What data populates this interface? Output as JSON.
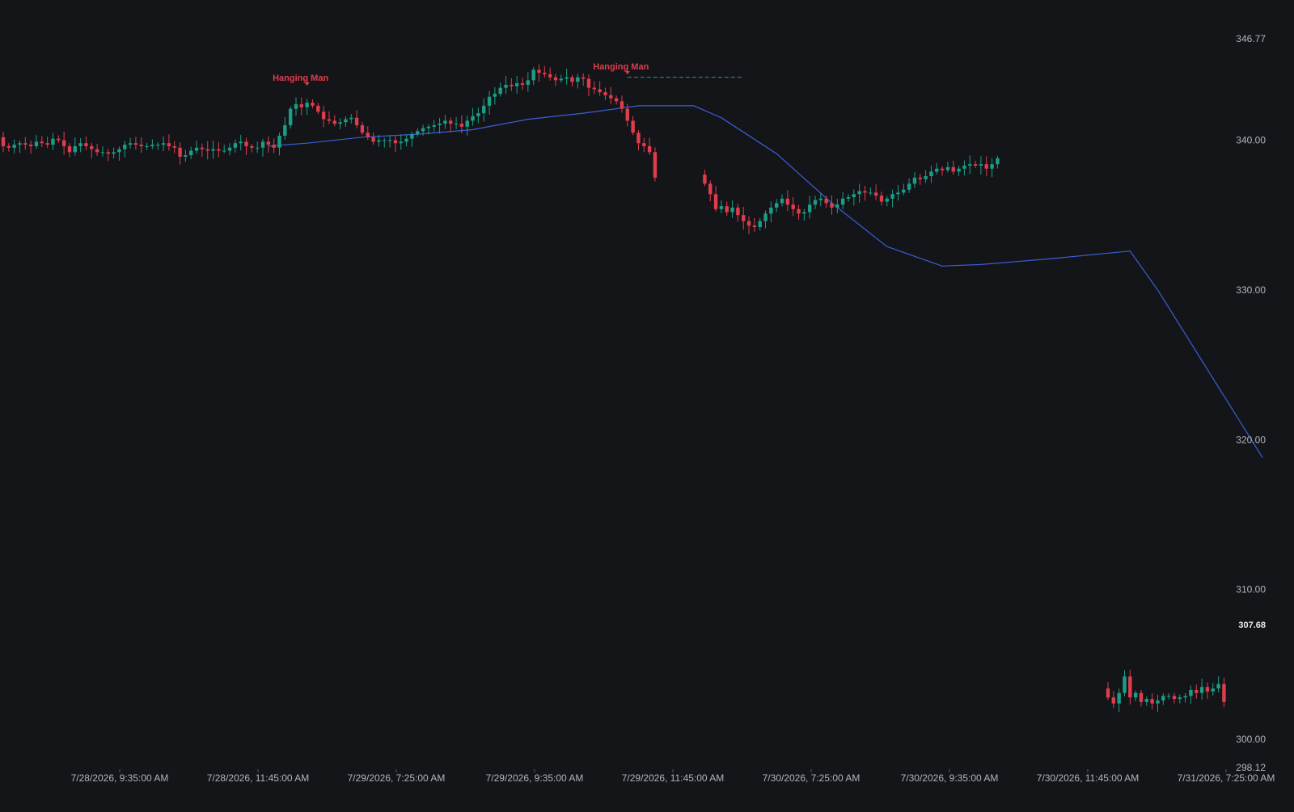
{
  "chart_data": {
    "type": "candlestick",
    "y_ticks": [
      346.77,
      340.0,
      330.0,
      320.0,
      310.0,
      300.0,
      298.12
    ],
    "ylim": [
      298.12,
      346.77
    ],
    "last_price_label": "307.68",
    "x_tick_labels": [
      "7/28/2026, 9:35:00 AM",
      "7/28/2026, 11:45:00 AM",
      "7/29/2026, 7:25:00 AM",
      "7/29/2026, 9:35:00 AM",
      "7/29/2026, 11:45:00 AM",
      "7/30/2026, 7:25:00 AM",
      "7/30/2026, 9:35:00 AM",
      "7/30/2026, 11:45:00 AM",
      "7/31/2026, 7:25:00 AM"
    ],
    "annotations": [
      {
        "text": "Hanging Man",
        "bar_index": 55
      },
      {
        "text": "Hanging Man",
        "bar_index": 113
      }
    ],
    "reference_line": {
      "price": 344.2,
      "from_bar": 113,
      "to_bar": 134
    },
    "moving_average": [
      {
        "bar": 48,
        "price": 339.6
      },
      {
        "bar": 55,
        "price": 339.8
      },
      {
        "bar": 65,
        "price": 340.2
      },
      {
        "bar": 75,
        "price": 340.4
      },
      {
        "bar": 85,
        "price": 340.7
      },
      {
        "bar": 95,
        "price": 341.4
      },
      {
        "bar": 105,
        "price": 341.8
      },
      {
        "bar": 115,
        "price": 342.3
      },
      {
        "bar": 125,
        "price": 342.3
      },
      {
        "bar": 130,
        "price": 341.5
      },
      {
        "bar": 140,
        "price": 339.1
      },
      {
        "bar": 150,
        "price": 335.8
      },
      {
        "bar": 160,
        "price": 332.9
      },
      {
        "bar": 170,
        "price": 331.6
      },
      {
        "bar": 177,
        "price": 331.7
      },
      {
        "bar": 190,
        "price": 332.1
      },
      {
        "bar": 204,
        "price": 332.6
      },
      {
        "bar": 209,
        "price": 330.0
      },
      {
        "bar": 228,
        "price": 318.8
      }
    ],
    "candle_segments": [
      {
        "start_bar": 0,
        "prices": [
          339.6,
          339.5,
          339.7,
          339.8,
          339.7,
          339.6,
          339.9,
          339.8,
          339.7,
          340.1,
          340.0,
          339.6,
          339.2,
          339.6,
          339.8,
          339.6,
          339.4,
          339.2,
          339.2,
          339.1,
          339.2,
          339.4,
          339.7,
          339.8,
          339.7,
          339.6,
          339.6,
          339.7,
          339.7,
          339.8,
          339.6,
          339.5,
          338.9,
          339.0,
          339.3,
          339.5,
          339.4,
          339.3,
          339.4,
          339.3,
          339.3,
          339.5,
          339.8,
          339.9,
          339.6,
          339.5,
          339.5,
          339.9,
          339.7,
          339.5,
          340.3,
          341.0,
          342.1,
          342.4,
          342.2,
          342.5,
          342.3,
          341.9,
          341.4,
          341.3,
          341.1,
          341.2,
          341.4,
          341.5,
          341.0,
          340.5,
          340.2,
          339.9,
          340.0,
          340.0,
          340.0,
          339.8,
          339.9,
          340.1,
          340.4,
          340.6,
          340.8,
          340.9,
          341.0,
          341.1,
          341.3,
          341.1,
          341.1,
          340.9,
          341.3,
          341.6,
          341.8,
          342.3,
          342.9,
          343.1,
          343.5,
          343.7,
          343.6,
          343.8,
          343.7,
          344.0,
          344.7,
          344.5,
          344.4,
          344.2,
          344.0,
          344.1,
          344.2,
          343.9,
          344.2,
          344.1,
          343.5,
          343.4,
          343.2,
          343.0,
          342.8,
          342.6,
          342.1,
          341.3,
          340.5,
          339.8,
          339.6,
          339.2,
          337.5
        ]
      },
      {
        "start_bar": 127,
        "prices": [
          337.1,
          336.4,
          335.4,
          335.6,
          335.2,
          335.5,
          335.0,
          334.6,
          334.3,
          334.2,
          334.6,
          335.1,
          335.5,
          335.8,
          336.1,
          335.7,
          335.4,
          335.1,
          335.2,
          335.7,
          336.0,
          336.1,
          335.8,
          335.5,
          335.7,
          336.1,
          336.2,
          336.4,
          336.6,
          336.5,
          336.5,
          336.3,
          335.9,
          336.1,
          336.4,
          336.5,
          336.7,
          337.1,
          337.5,
          337.4,
          337.6,
          337.9,
          338.1,
          338.0,
          338.2,
          337.9,
          338.1,
          338.3,
          338.4,
          338.3,
          338.4,
          338.1,
          338.4,
          338.8
        ]
      },
      {
        "start_bar": 200,
        "prices": [
          302.8,
          302.4,
          303.1,
          304.2,
          302.8,
          303.1,
          302.5,
          302.7,
          302.4,
          302.6,
          302.9,
          302.9,
          302.7,
          302.8,
          302.9,
          303.3,
          303.1,
          303.5,
          303.2,
          303.4,
          303.7,
          302.5
        ]
      }
    ]
  }
}
